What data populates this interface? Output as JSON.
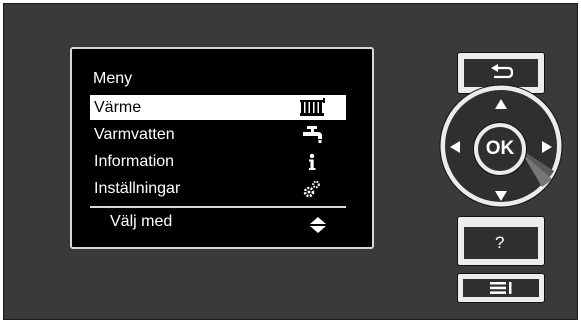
{
  "screen": {
    "title": "Meny",
    "items": [
      {
        "label": "Värme",
        "icon": "radiator-icon",
        "selected": true
      },
      {
        "label": "Varmvatten",
        "icon": "tap-icon",
        "selected": false
      },
      {
        "label": "Information",
        "icon": "info-icon",
        "selected": false
      },
      {
        "label": "Inställningar",
        "icon": "gears-icon",
        "selected": false
      }
    ],
    "footer": {
      "label": "Välj med",
      "icon": "up-down-arrows-icon"
    }
  },
  "controls": {
    "back_icon": "back-arrow-icon",
    "ok_label": "OK",
    "help_label": "?",
    "menu_icon": "menu-icon",
    "arrows": [
      "up-arrow-icon",
      "down-arrow-icon",
      "left-arrow-icon",
      "right-arrow-icon"
    ]
  },
  "colors": {
    "panel": "#3a3a3a",
    "screen": "#000000",
    "selection": "#ffffff",
    "accent": "#ffffff"
  }
}
